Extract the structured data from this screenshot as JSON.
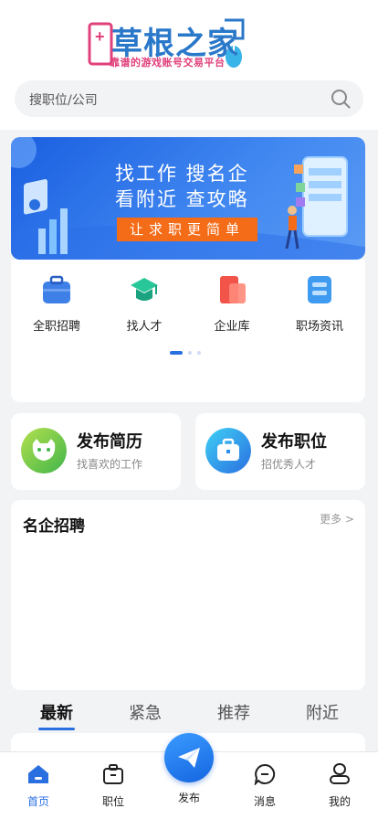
{
  "header": {
    "logo_title": "草根之家",
    "logo_subtitle": "靠谱的游戏账号交易平台",
    "search_placeholder": "搜职位/公司"
  },
  "banner": {
    "line1": "找工作    搜名企",
    "line2": "看附近    查攻略",
    "button": "让求职更简单"
  },
  "categories": [
    {
      "label": "全职招聘",
      "icon": "briefcase-icon"
    },
    {
      "label": "找人才",
      "icon": "graduation-cap-icon"
    },
    {
      "label": "企业库",
      "icon": "company-icon"
    },
    {
      "label": "职场资讯",
      "icon": "news-icon"
    }
  ],
  "carousel": {
    "pages": 3,
    "active": 1
  },
  "post_cards": [
    {
      "title": "发布简历",
      "subtitle": "找喜欢的工作",
      "icon": "resume-face-icon"
    },
    {
      "title": "发布职位",
      "subtitle": "招优秀人才",
      "icon": "job-briefcase-icon"
    }
  ],
  "famous": {
    "title": "名企招聘",
    "more": "更多 >"
  },
  "tabs": [
    "最新",
    "紧急",
    "推荐",
    "附近"
  ],
  "active_tab": "最新",
  "tabbar": {
    "items": [
      "首页",
      "职位",
      "发布",
      "消息",
      "我的"
    ],
    "active": "首页"
  },
  "colors": {
    "accent": "#2a6fe0",
    "banner_button": "#f56c18",
    "logo_pink": "#e0407b"
  }
}
